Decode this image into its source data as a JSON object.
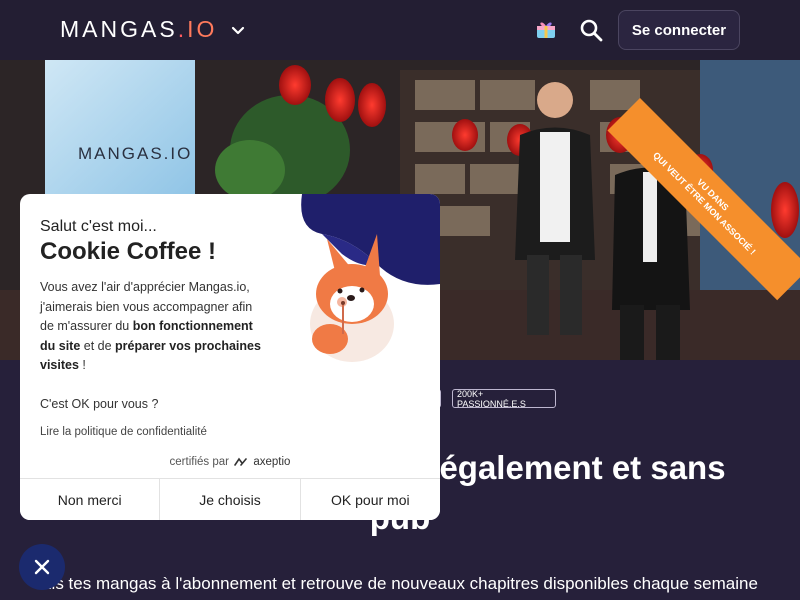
{
  "header": {
    "logo_main": "MANGAS",
    "logo_dot": ".",
    "logo_io": "IO",
    "menu_icon": "chevron-down-icon",
    "gift_icon": "gift-icon",
    "search_icon": "search-icon",
    "login_label": "Se connecter"
  },
  "hero": {
    "sign_text": "MANGAS.IO",
    "ribbon_line1": "VU DANS",
    "ribbon_line2": "QUI VEUT ÊTRE MON ASSOCIÉ !"
  },
  "main": {
    "badge_a": "",
    "badge_b": "200K+ PASSIONNÉ.E.S",
    "headline_line1": "également et sans",
    "headline_line2": "pub",
    "subline": "Lis tes mangas à l'abonnement et retrouve de nouveaux chapitres disponibles chaque semaine"
  },
  "cookie": {
    "greeting": "Salut c'est moi...",
    "title": "Cookie Coffee !",
    "body_part1": "Vous avez l'air d'apprécier Mangas.io, j'aimerais bien vous accompagner afin de m'assurer du ",
    "body_bold1": "bon fonctionnement du site",
    "body_part2": " et de ",
    "body_bold2": "préparer vos prochaines visites",
    "body_part3": " !",
    "question": "C'est OK pour vous ?",
    "policy_link": "Lire la politique de confidentialité",
    "certified_prefix": "certifiés par",
    "certified_brand": "axeptio",
    "btn_refuse": "Non merci",
    "btn_choose": "Je choisis",
    "btn_accept": "OK pour moi"
  },
  "close_icon": "close-icon",
  "colors": {
    "header_bg": "#231e33",
    "page_bg": "#26203a",
    "accent_orange": "#f58f2c",
    "close_fab": "#1b2a6e"
  }
}
